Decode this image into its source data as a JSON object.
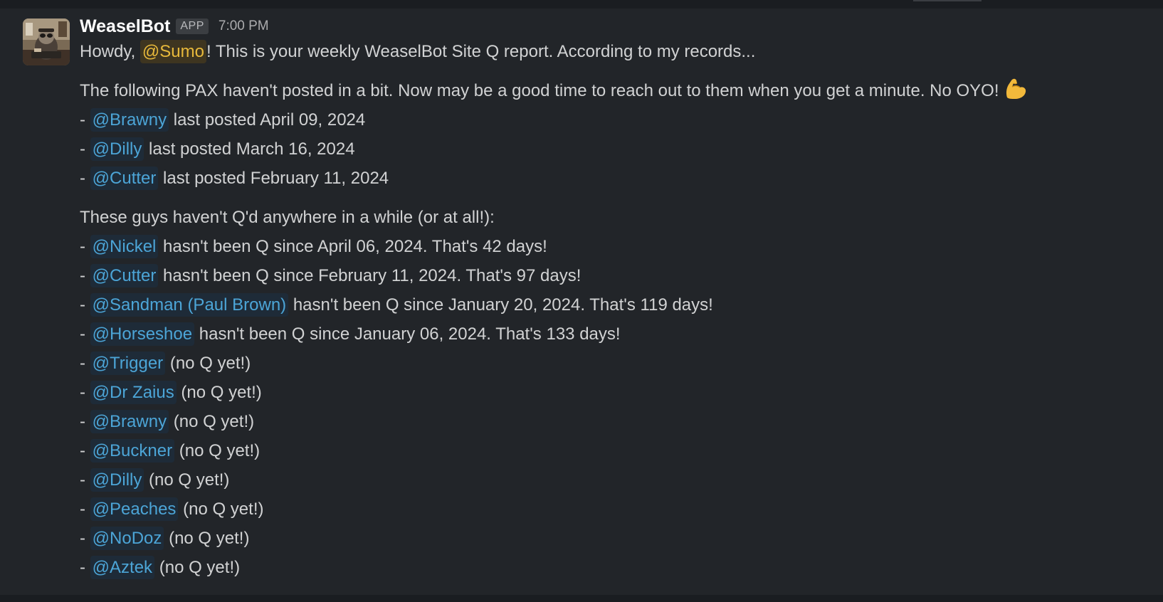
{
  "message": {
    "sender": "WeaselBot",
    "badge": "APP",
    "time": "7:00 PM",
    "greeting": {
      "prefix": "Howdy, ",
      "mention": "@Sumo",
      "suffix": "! This is your weekly WeaselBot Site Q report. According to my records..."
    },
    "posted_intro": "The following PAX haven't posted in a bit. Now may be a good time to reach out to them when you get a minute. No OYO!",
    "posted_emoji": "flexed-biceps",
    "posted": [
      {
        "dash": "- ",
        "mention": "@Brawny",
        "text": " last posted April 09, 2024"
      },
      {
        "dash": "- ",
        "mention": "@Dilly",
        "text": " last posted March 16, 2024"
      },
      {
        "dash": "- ",
        "mention": "@Cutter",
        "text": " last posted February 11, 2024"
      }
    ],
    "q_intro": "These guys haven't Q'd anywhere in a while (or at all!):",
    "q_list": [
      {
        "dash": "- ",
        "mention": "@Nickel",
        "text": " hasn't been Q since April 06, 2024. That's 42 days!"
      },
      {
        "dash": "- ",
        "mention": "@Cutter",
        "text": " hasn't been Q since February 11, 2024. That's 97 days!"
      },
      {
        "dash": "- ",
        "mention": "@Sandman (Paul Brown)",
        "text": " hasn't been Q since January 20, 2024. That's 119 days!"
      },
      {
        "dash": "- ",
        "mention": "@Horseshoe",
        "text": " hasn't been Q since January 06, 2024. That's 133 days!"
      },
      {
        "dash": "- ",
        "mention": "@Trigger",
        "text": " (no Q yet!)"
      },
      {
        "dash": "- ",
        "mention": "@Dr Zaius",
        "text": " (no Q yet!)"
      },
      {
        "dash": "- ",
        "mention": "@Brawny",
        "text": " (no Q yet!)"
      },
      {
        "dash": "- ",
        "mention": "@Buckner",
        "text": " (no Q yet!)"
      },
      {
        "dash": "- ",
        "mention": "@Dilly",
        "text": " (no Q yet!)"
      },
      {
        "dash": "- ",
        "mention": "@Peaches",
        "text": " (no Q yet!)"
      },
      {
        "dash": "- ",
        "mention": "@NoDoz",
        "text": " (no Q yet!)"
      },
      {
        "dash": "- ",
        "mention": "@Aztek",
        "text": " (no Q yet!)"
      }
    ]
  },
  "colors": {
    "background": "#222529",
    "mention": "#4ca5d7",
    "self_mention": "#e8b93b"
  }
}
